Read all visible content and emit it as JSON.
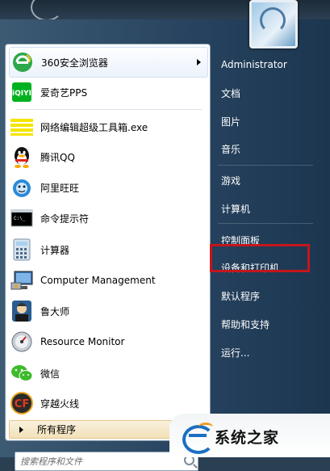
{
  "programs": [
    {
      "label": "360安全浏览器",
      "icon": "360-browser-icon",
      "has_submenu": true
    },
    {
      "label": "爱奇艺PPS",
      "icon": "iqiyi-icon",
      "has_submenu": false
    },
    {
      "label": "网络编辑超级工具箱.exe",
      "icon": "toolbox-icon",
      "has_submenu": false
    },
    {
      "label": "腾讯QQ",
      "icon": "qq-penguin-icon",
      "has_submenu": false
    },
    {
      "label": "阿里旺旺",
      "icon": "aliwangwang-icon",
      "has_submenu": false
    },
    {
      "label": "命令提示符",
      "icon": "command-prompt-icon",
      "has_submenu": false
    },
    {
      "label": "计算器",
      "icon": "calculator-icon",
      "has_submenu": false
    },
    {
      "label": "Computer Management",
      "icon": "computer-management-icon",
      "has_submenu": false
    },
    {
      "label": "鲁大师",
      "icon": "ludashi-icon",
      "has_submenu": false
    },
    {
      "label": "Resource Monitor",
      "icon": "resource-monitor-icon",
      "has_submenu": false
    },
    {
      "label": "微信",
      "icon": "wechat-icon",
      "has_submenu": false
    },
    {
      "label": "穿越火线",
      "icon": "crossfire-icon",
      "has_submenu": false
    }
  ],
  "all_programs": "所有程序",
  "search": {
    "placeholder": "搜索程序和文件"
  },
  "right_items": [
    "Administrator",
    "文档",
    "图片",
    "音乐",
    "游戏",
    "计算机",
    "控制面板",
    "设备和打印机",
    "默认程序",
    "帮助和支持",
    "运行..."
  ],
  "highlighted_item": "控制面板",
  "watermark": {
    "text": "系统之家"
  },
  "colors": {
    "highlight_border": "#c4161c",
    "menu_bg": "#26425e",
    "all_programs_bg": "#f2e1b9"
  }
}
